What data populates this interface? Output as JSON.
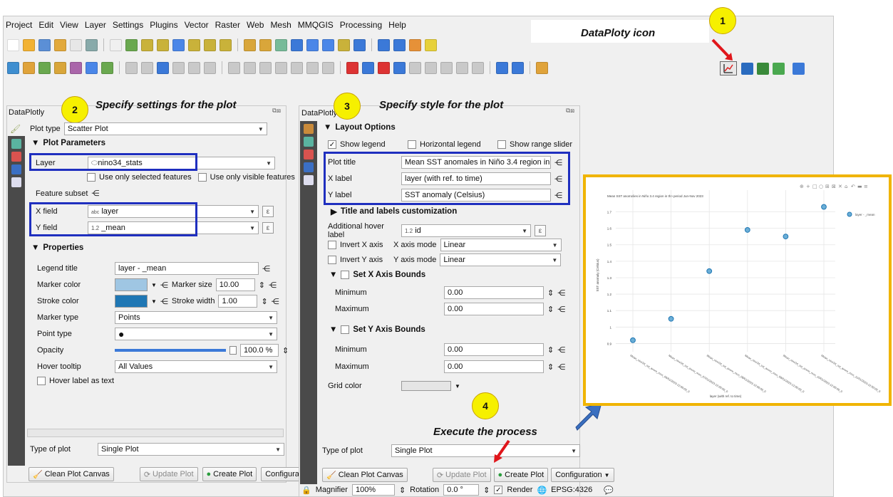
{
  "menu": [
    "Project",
    "Edit",
    "View",
    "Layer",
    "Settings",
    "Plugins",
    "Vector",
    "Raster",
    "Web",
    "Mesh",
    "MMQGIS",
    "Processing",
    "Help"
  ],
  "annotations": {
    "step1": "1",
    "step2": "2",
    "step3": "3",
    "step4": "4",
    "dataploty_icon": "DataPloty icon",
    "settings": "Specify settings for the plot",
    "style": "Specify style for the plot",
    "execute": "Execute the process"
  },
  "left_panel": {
    "title": "DataPlotly",
    "plot_type_label": "Plot type",
    "plot_type_value": "Scatter Plot",
    "plot_parameters": "Plot Parameters",
    "layer_label": "Layer",
    "layer_value": "nino34_stats",
    "use_selected": "Use only selected features",
    "use_visible": "Use only visible features",
    "feature_subset": "Feature subset",
    "x_field_label": "X field",
    "x_field_type": "abc",
    "x_field_value": "layer",
    "y_field_label": "Y field",
    "y_field_type": "1.2",
    "y_field_value": "_mean",
    "properties": "Properties",
    "legend_title_label": "Legend title",
    "legend_title_value": "layer - _mean",
    "marker_color_label": "Marker color",
    "marker_size_label": "Marker size",
    "marker_size_value": "10.00",
    "stroke_color_label": "Stroke color",
    "stroke_width_label": "Stroke width",
    "stroke_width_value": "1.00",
    "marker_type_label": "Marker type",
    "marker_type_value": "Points",
    "point_type_label": "Point type",
    "opacity_label": "Opacity",
    "opacity_value": "100.0 %",
    "opacity_fraction": 1.0,
    "hover_tooltip_label": "Hover tooltip",
    "hover_tooltip_value": "All Values",
    "hover_as_text": "Hover label as text",
    "type_of_plot_label": "Type of plot",
    "type_of_plot_value": "Single Plot",
    "clean_btn": "Clean Plot Canvas",
    "update_btn": "Update Plot",
    "create_btn": "Create Plot",
    "config_btn": "Configuration"
  },
  "right_panel": {
    "title": "DataPlotly",
    "layout_options": "Layout Options",
    "show_legend": "Show legend",
    "horizontal_legend": "Horizontal legend",
    "show_range_slider": "Show range slider",
    "plot_title_label": "Plot title",
    "plot_title_value": "Mean SST anomales in Niño 3.4 region in the p",
    "x_label_label": "X label",
    "x_label_value": "layer (with ref. to time)",
    "y_label_label": "Y label",
    "y_label_value": "SST anomaly (Celsius)",
    "title_custom": "Title and labels customization",
    "additional_hover_label": "Additional hover label",
    "additional_hover_type": "1.2",
    "additional_hover_value": "id",
    "invert_x": "Invert X axis",
    "x_axis_mode_label": "X axis mode",
    "x_axis_mode_value": "Linear",
    "invert_y": "Invert Y axis",
    "y_axis_mode_label": "Y axis mode",
    "y_axis_mode_value": "Linear",
    "set_x_bounds": "Set X Axis Bounds",
    "set_y_bounds": "Set Y Axis Bounds",
    "minimum_label": "Minimum",
    "maximum_label": "Maximum",
    "x_min": "0.00",
    "x_max": "0.00",
    "y_min": "0.00",
    "y_max": "0.00",
    "grid_color_label": "Grid color",
    "type_of_plot_label": "Type of plot",
    "type_of_plot_value": "Single Plot",
    "clean_btn": "Clean Plot Canvas",
    "update_btn": "Update Plot",
    "create_btn": "Create Plot",
    "config_btn": "Configuration"
  },
  "statusbar": {
    "magnifier_label": "Magnifier",
    "magnifier_value": "100%",
    "rotation_label": "Rotation",
    "rotation_value": "0.0 °",
    "render_label": "Render",
    "crs": "EPSG:4326"
  },
  "chart_data": {
    "type": "scatter",
    "title": "Mean SST anomalies in Niño 3.4 region in the period Jun-Nov 2023",
    "xlabel": "layer (with ref. to time)",
    "ylabel": "SST anomaly (Celsius)",
    "legend": "layer - _mean",
    "legend_position": "top-right",
    "grid": true,
    "ylim": [
      0.85,
      1.78
    ],
    "yticks": [
      "0.9",
      "1",
      "1.1",
      "1.2",
      "1.3",
      "1.4",
      "1.5",
      "1.6",
      "1.7"
    ],
    "categories": [
      "nino34_mon_06_2023",
      "nino34_mon_07_2023",
      "nino34_mon_08_2023",
      "nino34_mon_09_2023",
      "nino34_mon_10_2023",
      "nino34_mon_11_2023"
    ],
    "x_tick_labels": [
      "Mean_nino34_sst_anom_mon_06/01/2023-12:00:00_0",
      "Mean_nino34_sst_anom_mon_07/01/2023-12:00:00_0",
      "Mean_nino34_sst_anom_mon_08/01/2023-12:00:00_0",
      "Mean_nino34_sst_anom_mon_09/01/2023-12:00:00_0",
      "Mean_nino34_sst_anom_mon_10/01/2023-12:00:00_0",
      "Mean_nino34_sst_anom_mon_11/01/2023-12:00:00_0"
    ],
    "values": [
      0.92,
      1.05,
      1.34,
      1.59,
      1.55,
      1.73
    ]
  },
  "colors": {
    "annotation_box": "#1f2fbf",
    "plot_frame": "#f0b400",
    "marker": "#6baed6",
    "arrow_red": "#e0161b",
    "big_arrow": "#3a6fc0"
  }
}
